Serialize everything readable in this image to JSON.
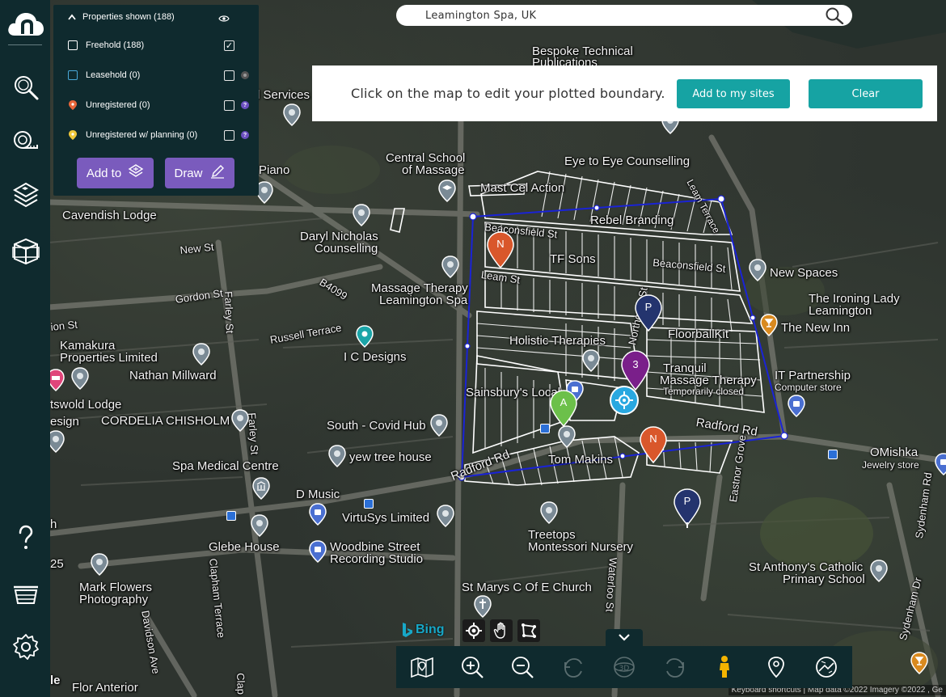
{
  "colors": {
    "panel_bg": "#0f2a2e",
    "accent_purple": "#7a5bbd",
    "accent_teal": "#16a3a3",
    "boundary_blue": "#1a23d6",
    "pin_orange": "#d9572b",
    "pin_navy": "#24346e",
    "pin_purple": "#7a1f8a",
    "pin_green": "#6cc04a",
    "pin_blue": "#29a8e0"
  },
  "search": {
    "value": "Leamington Spa, UK",
    "icon": "search-icon"
  },
  "boundary_bar": {
    "message": "Click on the map to edit your plotted boundary.",
    "add_button": "Add to my sites",
    "clear_button": "Clear"
  },
  "properties_panel": {
    "header": "Properties shown (188)",
    "rows": [
      {
        "label": "Freehold (188)",
        "swatch": "#ffffff",
        "checked": true,
        "info": ""
      },
      {
        "label": "Leasehold (0)",
        "swatch": "#4aa8d8",
        "checked": false,
        "info": "leasehold-info"
      },
      {
        "label": "Unregistered (0)",
        "swatch": "#e8663a",
        "checked": false,
        "info": "?"
      },
      {
        "label": "Unregistered w/ planning (0)",
        "swatch": "#f0c83a",
        "checked": false,
        "info": "?"
      }
    ],
    "add_to_label": "Add to",
    "draw_label": "Draw"
  },
  "sidebar": {
    "items": [
      "logo-icon",
      "search-icon",
      "measure-icon",
      "layers-icon",
      "map-box-icon",
      "help-icon",
      "basket-icon",
      "settings-icon"
    ]
  },
  "map_labels": {
    "bespoke": "Bespoke Technical",
    "publications": "Publications",
    "services": "l Services",
    "central_school": "Central School",
    "of_massage": "of Massage",
    "eye_to_eye": "Eye to Eye Counselling",
    "leam_terrace": "Leam Terrace",
    "piano": "Piano",
    "mast_cel": "Mast Cel Action",
    "rebel": "Rebel Branding",
    "beaconsfield_st": "Beaconsfield St",
    "beaconsfield_st2": "Beaconsfield St",
    "tf_sons": "TF Sons",
    "cavendish": "Cavendish Lodge",
    "daryl1": "Daryl Nicholas",
    "daryl2": "Counselling",
    "new_st": "New St",
    "leam_st": "Leam St",
    "new_spaces": "New Spaces",
    "gordon_st": "Gordon St",
    "b4099": "B4099",
    "massage1": "Massage Therapy",
    "massage2": "Leamington Spa",
    "ironing1": "The Ironing Lady",
    "ironing2": "Leamington",
    "farley_st": "Farley St",
    "ion_st": "ion St",
    "the_new_inn": "The New Inn",
    "russell": "Russell Terrace",
    "holistic1": "Holistic Therapies",
    "northcote": "Northcote St",
    "floorballkit": "FloorballKit",
    "kamakura1": "Kamakura",
    "kamakura2": "Properties Limited",
    "ic_designs": "I C Designs",
    "nathan": "Nathan Millward",
    "tranquil1": "Tranquil",
    "tranquil2": "Massage Therapy",
    "tranquil3": "Temporarily closed",
    "it_partnership": "IT Partnership",
    "computer_store": "Computer store",
    "cotswold": "tswold Lodge",
    "sainsburys": "Sainsbury's Local",
    "radford_rd_e": "Radford Rd",
    "design": "esign",
    "cordelia": "CORDELIA CHISHOLM",
    "farley_st2": "Farley St",
    "south_covid": "South - Covid Hub",
    "omishka": "OMishka",
    "jewelry": "Jewelry store",
    "yew_tree": "yew tree house",
    "radford_rd_w": "Radford Rd",
    "tom_makins": "Tom Makins",
    "eastnor": "Eastnor Grove",
    "spa_medical": "Spa Medical Centre",
    "d_music": "D Music",
    "virtusys": "VirtuSys Limited",
    "h": "h",
    "glebe": "Glebe House",
    "woodbine1": "Woodbine Street",
    "woodbine2": "Recording Studio",
    "treetops1": "Treetops",
    "treetops2": "Montessori Nursery",
    "sydenham": "Sydenham Rd",
    "st_anthony1": "St Anthony's Catholic",
    "st_anthony2": "Primary School",
    "num25": "25",
    "mark1": "Mark Flowers",
    "mark2": "Photography",
    "clapham": "Clapham Terrace",
    "st_marys": "St Marys C Of E Church",
    "davidson": "Davidson Ave",
    "waterloo": "Waterloo St",
    "sydenham_dr": "Sydenham Dr",
    "flor": "Flor Anterior",
    "le": "le",
    "clap": "Clap"
  },
  "pins": {
    "n1": "N",
    "p1": "P",
    "three": "3",
    "a": "A",
    "n2": "N",
    "p2": "P"
  },
  "bing": "Bing",
  "attribution": "Keyboard shortcuts | Map data ©2022 Imagery ©2022 , Ge"
}
